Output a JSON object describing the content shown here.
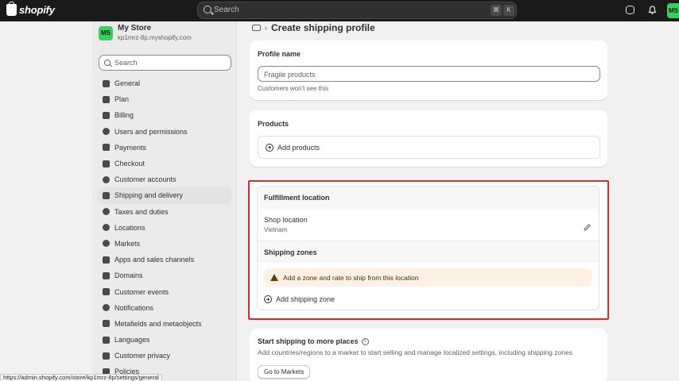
{
  "topbar": {
    "logo_text": "shopify",
    "search_placeholder": "Search",
    "shortcut_key1": "⌘",
    "shortcut_key2": "K",
    "avatar_initials": "MS"
  },
  "sidebar": {
    "store_initials": "MS",
    "store_name": "My Store",
    "store_url": "kp1mrz-8p.myshopify.com",
    "search_placeholder": "Search",
    "items": [
      {
        "label": "General",
        "icon": "store-icon"
      },
      {
        "label": "Plan",
        "icon": "plan-icon"
      },
      {
        "label": "Billing",
        "icon": "billing-icon"
      },
      {
        "label": "Users and permissions",
        "icon": "users-icon"
      },
      {
        "label": "Payments",
        "icon": "payments-icon"
      },
      {
        "label": "Checkout",
        "icon": "cart-icon"
      },
      {
        "label": "Customer accounts",
        "icon": "person-icon"
      },
      {
        "label": "Shipping and delivery",
        "icon": "truck-icon"
      },
      {
        "label": "Taxes and duties",
        "icon": "tax-icon"
      },
      {
        "label": "Locations",
        "icon": "location-icon"
      },
      {
        "label": "Markets",
        "icon": "globe-icon"
      },
      {
        "label": "Apps and sales channels",
        "icon": "apps-icon"
      },
      {
        "label": "Domains",
        "icon": "domains-icon"
      },
      {
        "label": "Customer events",
        "icon": "events-icon"
      },
      {
        "label": "Notifications",
        "icon": "bell-icon"
      },
      {
        "label": "Metafields and metaobjects",
        "icon": "metafields-icon"
      },
      {
        "label": "Languages",
        "icon": "languages-icon"
      },
      {
        "label": "Customer privacy",
        "icon": "lock-icon"
      },
      {
        "label": "Policies",
        "icon": "policies-icon"
      }
    ],
    "active_index": 7
  },
  "main": {
    "page_title": "Create shipping profile",
    "profile_name": {
      "title": "Profile name",
      "value": "Fragile products",
      "helper": "Customers won't see this"
    },
    "products": {
      "title": "Products",
      "add_label": "Add products"
    },
    "fulfillment": {
      "title": "Fulfillment location",
      "location_name": "Shop location",
      "location_country": "Vietnam",
      "zones_title": "Shipping zones",
      "warning": "Add a zone and rate to ship from this location",
      "add_zone_label": "Add shipping zone"
    },
    "more_places": {
      "title": "Start shipping to more places",
      "description": "Add countries/regions to a market to start selling and manage localized settings, including shipping zones",
      "button": "Go to Markets"
    }
  },
  "status_url": "https://admin.shopify.com/store/kp1mrz-8p/settings/general",
  "colors": {
    "topbar": "#1a1a1a",
    "accent_green": "#36d15e",
    "highlight_red": "#d72c2c",
    "warning_bg": "#fff1e3"
  }
}
